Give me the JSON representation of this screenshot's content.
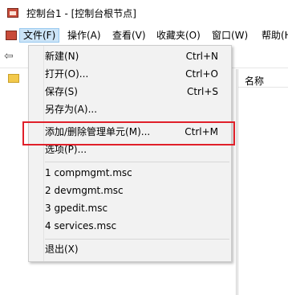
{
  "window": {
    "title": "控制台1 - [控制台根节点]"
  },
  "menubar": {
    "items": [
      "文件(F)",
      "操作(A)",
      "查看(V)",
      "收藏夹(O)",
      "窗口(W)",
      "帮助(H)"
    ],
    "active_index": 0
  },
  "right_pane": {
    "column_header": "名称"
  },
  "file_menu": {
    "items": [
      {
        "label": "新建(N)",
        "shortcut": "Ctrl+N"
      },
      {
        "label": "打开(O)...",
        "shortcut": "Ctrl+O"
      },
      {
        "label": "保存(S)",
        "shortcut": "Ctrl+S"
      },
      {
        "label": "另存为(A)...",
        "shortcut": ""
      },
      {
        "label": "添加/删除管理单元(M)...",
        "shortcut": "Ctrl+M"
      },
      {
        "label": "选项(P)...",
        "shortcut": ""
      },
      {
        "label": "1 compmgmt.msc",
        "shortcut": ""
      },
      {
        "label": "2 devmgmt.msc",
        "shortcut": ""
      },
      {
        "label": "3 gpedit.msc",
        "shortcut": ""
      },
      {
        "label": "4 services.msc",
        "shortcut": ""
      },
      {
        "label": "退出(X)",
        "shortcut": ""
      }
    ],
    "highlighted_index": 4
  },
  "colors": {
    "menu_active_bg": "#cce4f7",
    "highlight_border": "#e0202a"
  }
}
